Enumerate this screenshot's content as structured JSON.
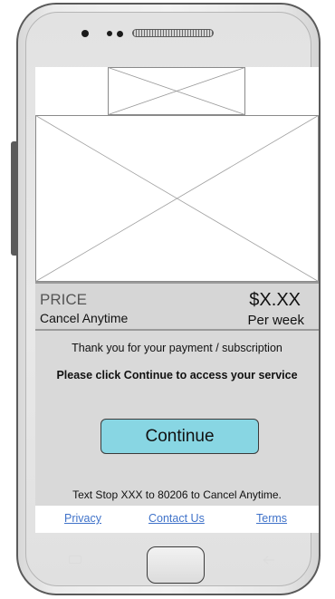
{
  "price_bar": {
    "price_label": "PRICE",
    "cancel_label": "Cancel Anytime",
    "price_value": "$X.XX",
    "period": "Per week"
  },
  "content": {
    "thanks_text": "Thank you for your payment / subscription",
    "instruction_text": "Please click Continue to access your service",
    "continue_label": "Continue",
    "stop_text": "Text Stop XXX to 80206 to Cancel Anytime."
  },
  "footer": {
    "links": [
      "Privacy",
      "Contact Us",
      "Terms"
    ]
  },
  "colors": {
    "continue_button": "#88d6e3",
    "link": "#3f72c9",
    "content_background": "#d9d9d9",
    "price_bar_background": "#d6d6d6"
  },
  "icons": [
    "camera-icon",
    "sensor-icon",
    "speaker-grille-icon",
    "menu-key-icon",
    "home-button-icon",
    "back-key-icon",
    "image-placeholder-icon"
  ]
}
